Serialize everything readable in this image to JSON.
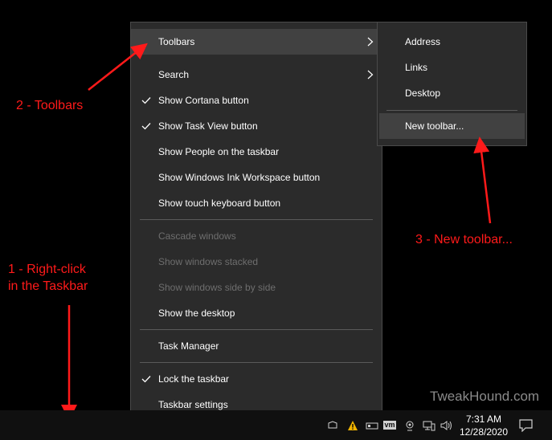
{
  "main_menu": {
    "items": [
      {
        "label": "Toolbars",
        "checked": false,
        "disabled": false,
        "submenu": true,
        "highlighted": true
      },
      {
        "label": "Search",
        "checked": false,
        "disabled": false,
        "submenu": true
      },
      {
        "label": "Show Cortana button",
        "checked": true,
        "disabled": false
      },
      {
        "label": "Show Task View button",
        "checked": true,
        "disabled": false
      },
      {
        "label": "Show People on the taskbar",
        "checked": false,
        "disabled": false
      },
      {
        "label": "Show Windows Ink Workspace button",
        "checked": false,
        "disabled": false
      },
      {
        "label": "Show touch keyboard button",
        "checked": false,
        "disabled": false
      },
      {
        "label": "Cascade windows",
        "checked": false,
        "disabled": true
      },
      {
        "label": "Show windows stacked",
        "checked": false,
        "disabled": true
      },
      {
        "label": "Show windows side by side",
        "checked": false,
        "disabled": true
      },
      {
        "label": "Show the desktop",
        "checked": false,
        "disabled": false
      },
      {
        "label": "Task Manager",
        "checked": false,
        "disabled": false
      },
      {
        "label": "Lock the taskbar",
        "checked": true,
        "disabled": false
      },
      {
        "label": "Taskbar settings",
        "checked": false,
        "disabled": false
      }
    ]
  },
  "toolbars_submenu": {
    "items": [
      {
        "label": "Address"
      },
      {
        "label": "Links"
      },
      {
        "label": "Desktop"
      },
      {
        "label": "New toolbar...",
        "highlighted": true
      }
    ]
  },
  "annotations": {
    "step1_line1": "1 - Right-click",
    "step1_line2": "in the Taskbar",
    "step2": "2 - Toolbars",
    "step3": "3 - New toolbar..."
  },
  "watermark": "TweakHound.com",
  "taskbar": {
    "time": "7:31 AM",
    "date": "12/28/2020",
    "vm_badge": "vm"
  },
  "icons": {
    "check": "checkmark-icon",
    "arrow": "chevron-right-icon",
    "notification": "action-center-icon"
  },
  "colors": {
    "menu_bg": "#2b2b2b",
    "highlight": "#414141",
    "annotation_red": "#ff1a1a",
    "taskbar_bg": "#101010"
  }
}
